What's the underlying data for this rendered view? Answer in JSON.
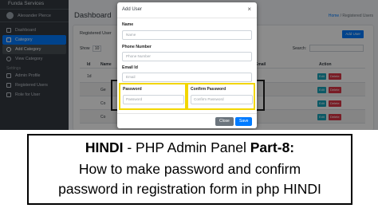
{
  "sidebar": {
    "brand": "Funda Services",
    "user": "Alexander Pierce",
    "items": [
      {
        "label": "Dashboard"
      },
      {
        "label": "Category"
      },
      {
        "label": "Add Category"
      },
      {
        "label": "View Category"
      }
    ],
    "section": "Settings",
    "admin_items": [
      {
        "label": "Admin Profile"
      },
      {
        "label": "Registered Users"
      },
      {
        "label": "Role for User"
      }
    ]
  },
  "main": {
    "title": "Dashboard",
    "breadcrumb": {
      "home": "Home",
      "current": "Registered Users"
    },
    "card_title": "Registered User",
    "add_button": "Add User",
    "show": "Show",
    "entries": "10",
    "search": "Search:",
    "columns": [
      "Id",
      "Name",
      "Email",
      "Action"
    ],
    "rows": [
      {
        "id": "1d",
        "name": "",
        "email": "",
        "edit": "Edit",
        "delete": "Delete"
      },
      {
        "id": "",
        "name": "Ge",
        "email": "",
        "edit": "Edit",
        "delete": "Delete"
      },
      {
        "id": "",
        "name": "Co",
        "email": "",
        "edit": "Edit",
        "delete": "Delete"
      },
      {
        "id": "",
        "name": "Co",
        "email": "",
        "edit": "Edit",
        "delete": "Delete"
      }
    ]
  },
  "modal": {
    "title": "Add User",
    "close_x": "×",
    "name_label": "Name",
    "name_placeholder": "Name",
    "phone_label": "Phone Number",
    "phone_placeholder": "Phone Number",
    "email_label": "Email Id",
    "email_placeholder": "Email",
    "password_label": "Password",
    "password_placeholder": "Password",
    "confirm_label": "Confirm Password",
    "confirm_placeholder": "Confirm Password",
    "close_button": "Close",
    "save_button": "Save"
  },
  "banner": {
    "hindi": "HINDI",
    "dash": " - PHP Admin Panel ",
    "part": "Part-8:",
    "line2": "How to make password and confirm",
    "line3": "password in registration form in php HINDI"
  },
  "colors": {
    "sidebar": "#343a40",
    "primary": "#007bff",
    "highlight_yellow": "#f2d600",
    "danger": "#dc3545",
    "info": "#17a2b8"
  }
}
